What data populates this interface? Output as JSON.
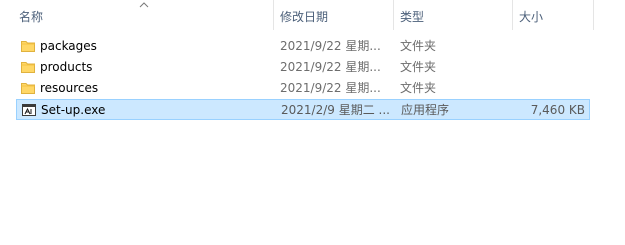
{
  "columns": {
    "name": "名称",
    "date": "修改日期",
    "type": "类型",
    "size": "大小"
  },
  "sort": {
    "column": "name",
    "direction": "ascending"
  },
  "files": [
    {
      "name": "packages",
      "date": "2021/9/22 星期...",
      "type": "文件夹",
      "size": "",
      "icon": "folder-icon"
    },
    {
      "name": "products",
      "date": "2021/9/22 星期...",
      "type": "文件夹",
      "size": "",
      "icon": "folder-icon"
    },
    {
      "name": "resources",
      "date": "2021/9/22 星期...",
      "type": "文件夹",
      "size": "",
      "icon": "folder-icon"
    },
    {
      "name": "Set-up.exe",
      "date": "2021/2/9 星期二 ...",
      "type": "应用程序",
      "size": "7,460 KB",
      "icon": "executable-icon",
      "selected": true
    }
  ],
  "colors": {
    "header_text": "#4c607a",
    "selection_bg": "#cce8ff",
    "selection_border": "#99d1ff",
    "folder": "#ffd766"
  }
}
